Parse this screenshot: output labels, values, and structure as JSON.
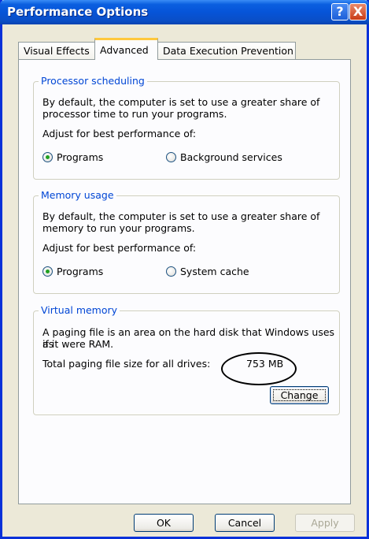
{
  "window": {
    "title": "Performance Options",
    "help_btn": "?",
    "close_btn": "X"
  },
  "tabs": [
    {
      "label": "Visual Effects"
    },
    {
      "label": "Advanced"
    },
    {
      "label": "Data Execution Prevention"
    }
  ],
  "processor": {
    "legend": "Processor scheduling",
    "desc1": "By default, the computer is set to use a greater share of",
    "desc2": "processor time to run your programs.",
    "adjust": "Adjust for best performance of:",
    "opt1": "Programs",
    "opt2": "Background services",
    "opt1_checked": true
  },
  "memory": {
    "legend": "Memory usage",
    "desc1": "By default, the computer is set to use a greater share of",
    "desc2": "memory to run your programs.",
    "adjust": "Adjust for best performance of:",
    "opt1": "Programs",
    "opt2": "System cache",
    "opt1_checked": true
  },
  "virtual": {
    "legend": "Virtual memory",
    "desc1": "A paging file is an area on the hard disk that Windows uses as",
    "desc2": "if it were RAM.",
    "total_label": "Total paging file size for all drives:",
    "total_value": "753 MB",
    "change_btn": "Change"
  },
  "footer": {
    "ok": "OK",
    "cancel": "Cancel",
    "apply": "Apply"
  },
  "colors": {
    "title_bar": "#0654d8",
    "legend": "#0046d5",
    "dialog_bg": "#ece9d8",
    "selected_tab_accent": "#ffc83c"
  }
}
